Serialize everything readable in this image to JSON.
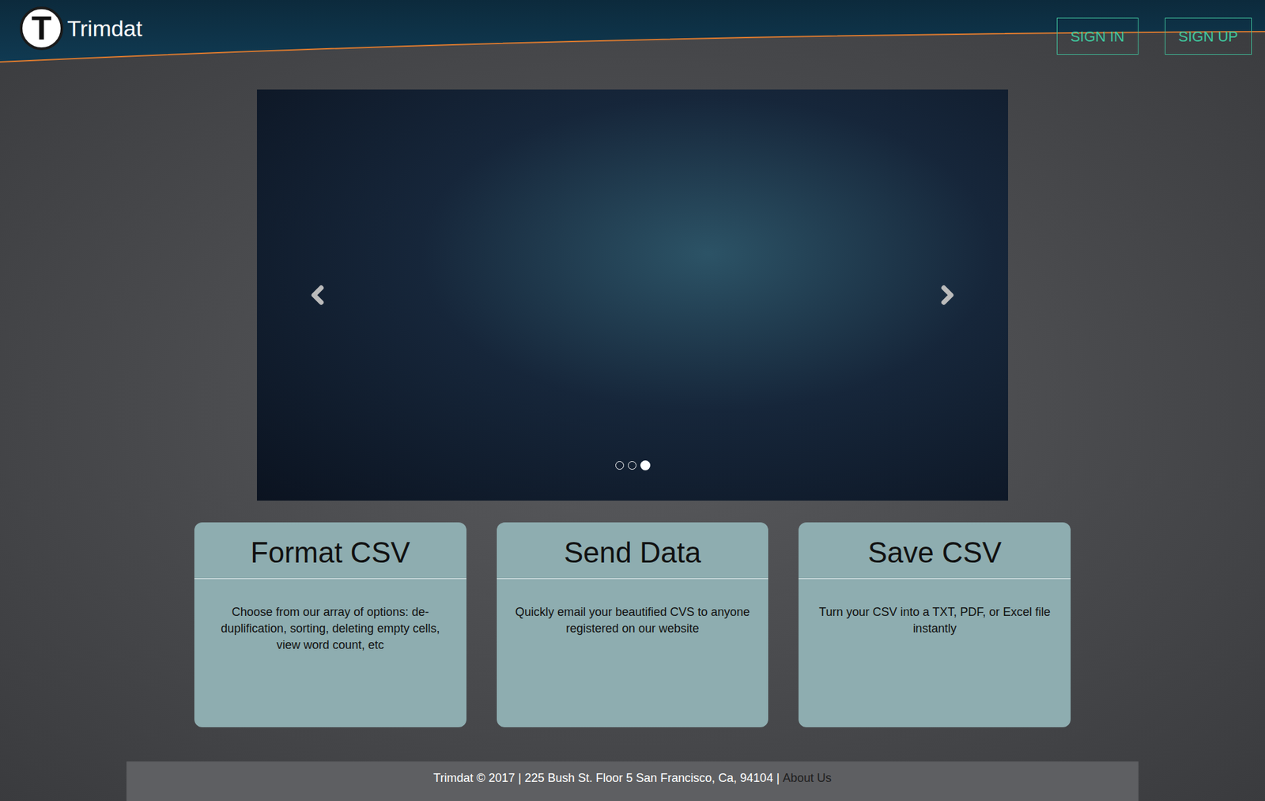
{
  "header": {
    "brand": "Trimdat",
    "logo_letter": "T",
    "buttons": [
      "SIGN IN",
      "SIGN UP"
    ]
  },
  "carousel": {
    "slides": [
      {
        "selected": false
      },
      {
        "selected": false
      },
      {
        "selected": true
      }
    ]
  },
  "cards": [
    {
      "title": "Format CSV",
      "body": "Choose from our array of options: de-duplification, sorting, deleting empty cells, view word count, etc"
    },
    {
      "title": "Send Data",
      "body": "Quickly email your beautified CVS to anyone registered on our website"
    },
    {
      "title": "Save CSV",
      "body": "Turn your CSV into a TXT, PDF, or Excel file instantly"
    }
  ],
  "footer": {
    "text": "Trimdat © 2017 | 225 Bush St. Floor 5 San Francisco, Ca, 94104 |",
    "link": "About Us"
  }
}
